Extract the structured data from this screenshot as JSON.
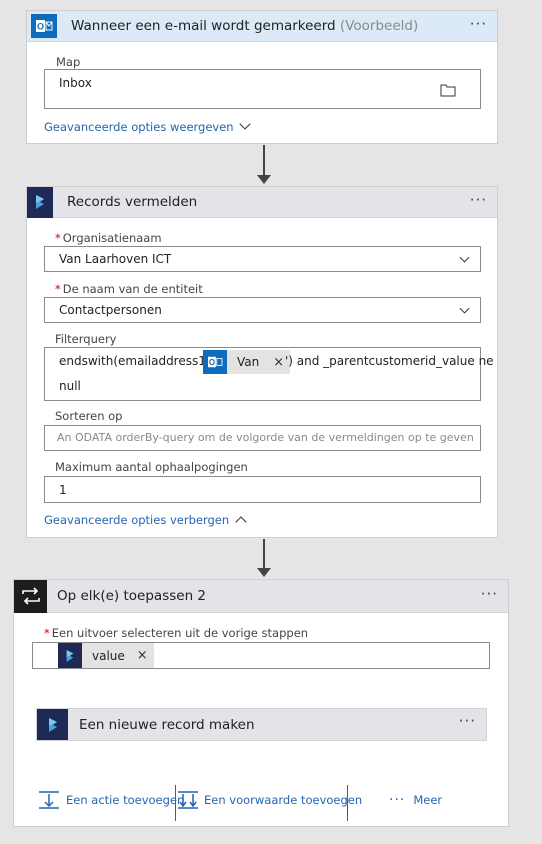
{
  "trigger": {
    "title": "Wanneer een e-mail wordt gemarkeerd",
    "badge": "(Voorbeeld)",
    "more": "···",
    "map_label": "Map",
    "map_value": "Inbox",
    "advanced_link": "Geavanceerde opties weergeven"
  },
  "records": {
    "title": "Records vermelden",
    "more": "···",
    "org_label": "Organisatienaam",
    "org_value": "Van Laarhoven ICT",
    "entity_label": "De naam van de entiteit",
    "entity_value": "Contactpersonen",
    "filter_label": "Filterquery",
    "filter_prefix": "endswith(emailaddress1,'",
    "filter_token": "Van",
    "filter_suffix": "') and _parentcustomerid_value ne",
    "filter_line2": "null",
    "sort_label": "Sorteren op",
    "sort_placeholder": "An ODATA orderBy-query om de volgorde van de vermeldingen op te geven",
    "max_label": "Maximum aantal ophaalpogingen",
    "max_value": "1",
    "advanced_link": "Geavanceerde opties verbergen"
  },
  "foreach": {
    "title": "Op elk(e) toepassen 2",
    "more": "···",
    "select_label": "Een uitvoer selecteren uit de vorige stappen",
    "select_token": "value",
    "inner_title": "Een nieuwe record maken",
    "inner_more": "···",
    "add_action": "Een actie toevoegen",
    "add_condition": "Een voorwaarde toevoegen",
    "more_label": "Meer",
    "more_dots": "···"
  },
  "colors": {
    "outlook_blue": "#0f6cbd",
    "dynamics_navy": "#1e2a55",
    "link_blue": "#2465b3",
    "trigger_header": "#dbeaf6",
    "action_header": "#e3e3e8"
  },
  "icons": {
    "trigger": "outlook-icon",
    "records": "dynamics-icon",
    "foreach": "loop-icon"
  }
}
